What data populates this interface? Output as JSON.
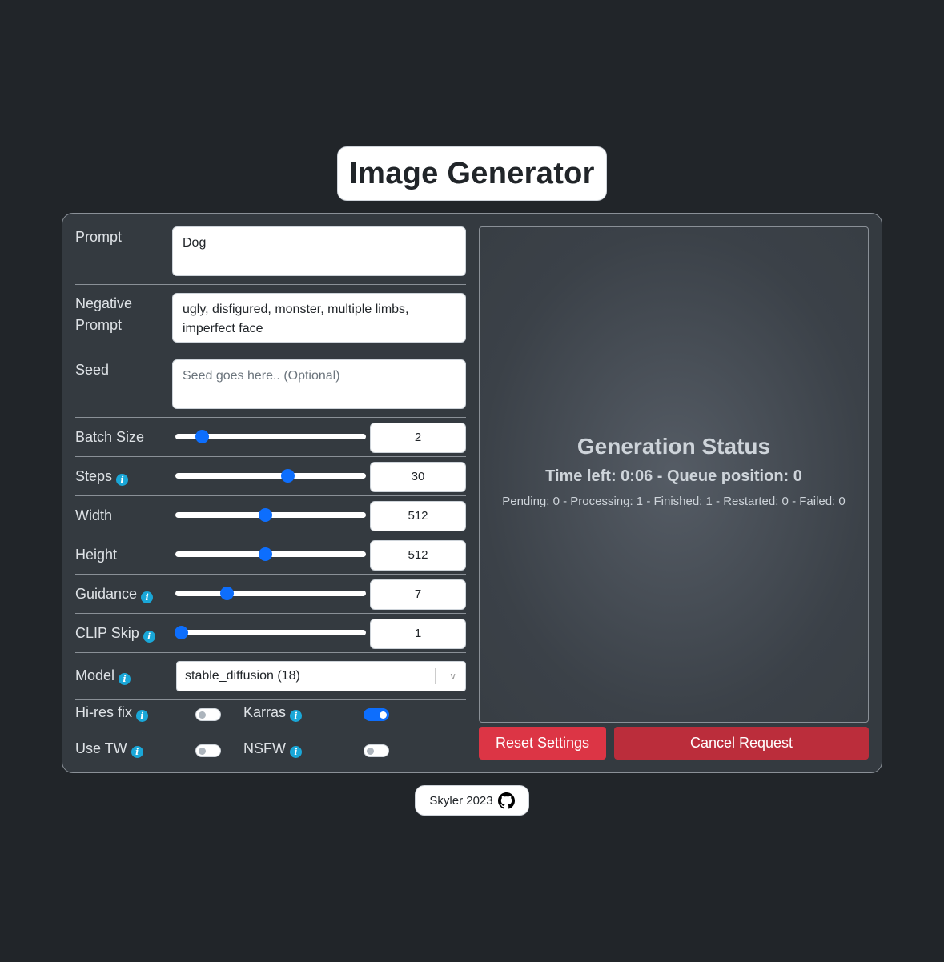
{
  "title": "Image Generator",
  "form": {
    "prompt": {
      "label": "Prompt",
      "value": "Dog"
    },
    "negative_prompt": {
      "label": "Negative Prompt",
      "value": "ugly, disfigured, monster, multiple limbs, imperfect face"
    },
    "seed": {
      "label": "Seed",
      "value": "",
      "placeholder": "Seed goes here.. (Optional)"
    },
    "batch_size": {
      "label": "Batch Size",
      "value": "2",
      "fraction": 0.14
    },
    "steps": {
      "label": "Steps",
      "value": "30",
      "fraction": 0.59
    },
    "width": {
      "label": "Width",
      "value": "512",
      "fraction": 0.47
    },
    "height": {
      "label": "Height",
      "value": "512",
      "fraction": 0.47
    },
    "guidance": {
      "label": "Guidance",
      "value": "7",
      "fraction": 0.27
    },
    "clip_skip": {
      "label": "CLIP Skip",
      "value": "1",
      "fraction": 0.03
    },
    "model": {
      "label": "Model",
      "value": "stable_diffusion (18)"
    },
    "hires_fix": {
      "label": "Hi-res fix",
      "on": false
    },
    "karras": {
      "label": "Karras",
      "on": true
    },
    "use_tw": {
      "label": "Use TW",
      "on": false
    },
    "nsfw": {
      "label": "NSFW",
      "on": false
    }
  },
  "status": {
    "heading": "Generation Status",
    "time_line": "Time left: 0:06 - Queue position: 0",
    "counts_line": "Pending: 0 - Processing: 1 - Finished: 1 - Restarted: 0 - Failed: 0"
  },
  "buttons": {
    "reset": "Reset Settings",
    "cancel": "Cancel Request"
  },
  "footer": {
    "text": "Skyler 2023",
    "icon": "github-icon"
  },
  "colors": {
    "accent": "#0d6efd",
    "danger": "#dc3545",
    "danger_dark": "#bb2d3b",
    "info": "#1aa7d8",
    "background": "#212529",
    "panel": "#343a40"
  }
}
